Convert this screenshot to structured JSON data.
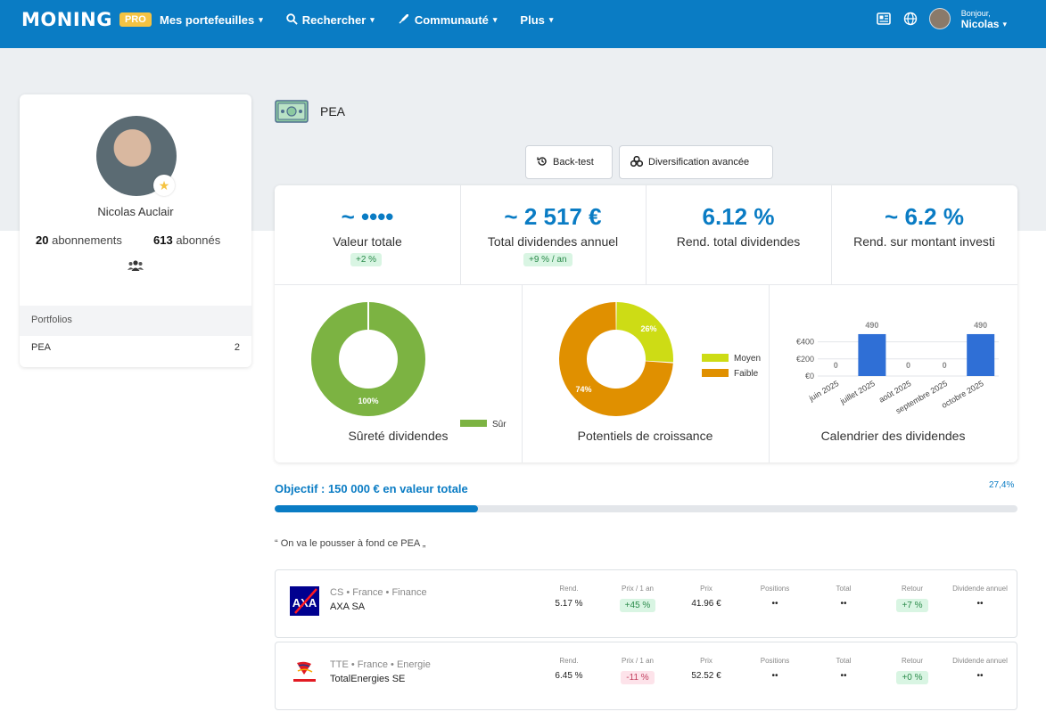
{
  "nav": {
    "logo_text": "MONING",
    "pro_label": "PRO",
    "items": [
      {
        "label": "Mes portefeuilles"
      },
      {
        "label": "Rechercher"
      },
      {
        "label": "Communauté"
      },
      {
        "label": "Plus"
      }
    ],
    "greeting": "Bonjour,",
    "user": "Nicolas"
  },
  "profile": {
    "name": "Nicolas Auclair",
    "subscriptions_count": "20",
    "subscriptions_label": "abonnements",
    "followers_count": "613",
    "followers_label": "abonnés",
    "portfolios_header": "Portfolios",
    "portfolios": [
      {
        "name": "PEA",
        "count": "2"
      }
    ]
  },
  "portfolio": {
    "title": "PEA",
    "backtest_label": "Back-test",
    "diversification_label": "Diversification avancée"
  },
  "kpis": [
    {
      "value": "~ ••••",
      "label": "Valeur totale",
      "badge": "+2 %"
    },
    {
      "value": "~ 2 517 €",
      "label": "Total dividendes annuel",
      "badge": "+9 % / an"
    },
    {
      "value": "6.12 %",
      "label": "Rend. total dividendes",
      "badge": ""
    },
    {
      "value": "~ 6.2 %",
      "label": "Rend. sur montant investi",
      "badge": ""
    }
  ],
  "charts": {
    "safety_title": "Sûreté dividendes",
    "growth_title": "Potentiels de croissance",
    "calendar_title": "Calendrier des dividendes"
  },
  "chart_data": [
    {
      "type": "pie",
      "title": "Sûreté dividendes",
      "labels": [
        "Sûr"
      ],
      "values": [
        100
      ],
      "data_labels": [
        "100%"
      ],
      "colors": [
        "#7cb342"
      ]
    },
    {
      "type": "pie",
      "title": "Potentiels de croissance",
      "labels": [
        "Moyen",
        "Faible"
      ],
      "values": [
        26,
        74
      ],
      "data_labels": [
        "26%",
        "74%"
      ],
      "colors": [
        "#cddc15",
        "#e09000"
      ]
    },
    {
      "type": "bar",
      "title": "Calendrier des dividendes",
      "categories": [
        "juin 2025",
        "juillet 2025",
        "août 2025",
        "septembre 2025",
        "octobre 2025"
      ],
      "values": [
        0,
        490,
        0,
        0,
        490
      ],
      "data_labels": [
        "0",
        "490",
        "0",
        "0",
        "490"
      ],
      "yticks": [
        "€0",
        "€200",
        "€400"
      ],
      "ylim": [
        0,
        500
      ],
      "color": "#2f6fd6"
    }
  ],
  "objective": {
    "label": "Objectif : 150 000 € en valeur totale",
    "percent_text": "27,4%",
    "fraction": 0.274
  },
  "quote": "“ On va le pousser à fond ce PEA „",
  "holdings": {
    "headers": {
      "rend": "Rend.",
      "prix1an": "Prix / 1 an",
      "prix": "Prix",
      "positions": "Positions",
      "total": "Total",
      "retour": "Retour",
      "dividende": "Dividende annuel"
    },
    "rows": [
      {
        "meta": "CS • France • Finance",
        "name": "AXA SA",
        "rend": "5.17 %",
        "prix1an": "+45 %",
        "prix": "41.96 €",
        "positions": "••",
        "total": "••",
        "retour": "+7 %",
        "dividende": "••"
      },
      {
        "meta": "TTE • France • Energie",
        "name": "TotalEnergies SE",
        "rend": "6.45 %",
        "prix1an": "-11 %",
        "prix": "52.52 €",
        "positions": "••",
        "total": "••",
        "retour": "+0 %",
        "dividende": "••"
      }
    ]
  }
}
